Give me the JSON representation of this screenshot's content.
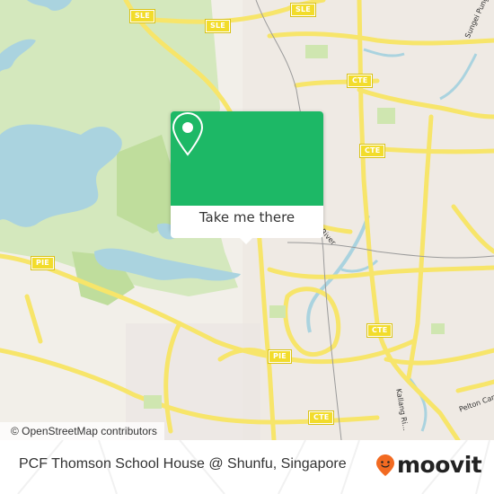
{
  "map": {
    "attribution": "© OpenStreetMap contributors",
    "highway_shields": [
      {
        "id": "sle-1",
        "label": "SLE"
      },
      {
        "id": "sle-2",
        "label": "SLE"
      },
      {
        "id": "sle-3",
        "label": "SLE"
      },
      {
        "id": "cte-1",
        "label": "CTE"
      },
      {
        "id": "cte-2",
        "label": "CTE"
      },
      {
        "id": "cte-3",
        "label": "CTE"
      },
      {
        "id": "cte-4",
        "label": "CTE"
      },
      {
        "id": "pie-1",
        "label": "PIE"
      },
      {
        "id": "pie-2",
        "label": "PIE"
      }
    ],
    "road_labels": [
      {
        "id": "sungei-punggol",
        "label": "Sungei Pung..."
      },
      {
        "id": "kallang-river",
        "label": "...ng River"
      },
      {
        "id": "kallang-river-2",
        "label": "Kallang Ri..."
      },
      {
        "id": "pelton-canal",
        "label": "Pelton Canal"
      }
    ],
    "colors": {
      "water": "#aad3df",
      "park": "#cfe6b0",
      "land": "#f2efe9",
      "motorway": "#f7e56a",
      "shield": "#f2dc2b"
    }
  },
  "popup": {
    "cta_label": "Take me there",
    "icon": "location-pin-icon",
    "color": "#1db866"
  },
  "footer": {
    "place_name": "PCF Thomson School House @ Shunfu, Singapore",
    "brand": "moovit",
    "brand_icon": "moovit-smiley-pin-icon",
    "brand_color": "#f26a21"
  }
}
